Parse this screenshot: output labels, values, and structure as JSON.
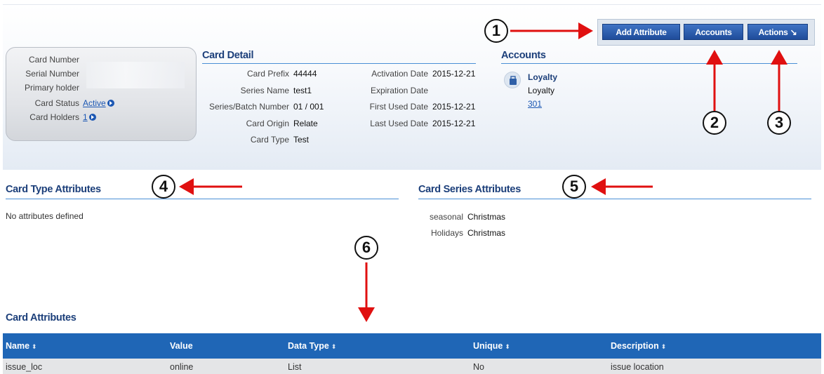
{
  "summary": {
    "card_number_label": "Card Number",
    "serial_number_label": "Serial Number",
    "primary_holder_label": "Primary holder",
    "card_status_label": "Card Status",
    "card_status_value": "Active",
    "card_holders_label": "Card Holders",
    "card_holders_value": "1"
  },
  "card_detail": {
    "title": "Card Detail",
    "left": [
      {
        "label": "Card Prefix",
        "value": "44444"
      },
      {
        "label": "Series Name",
        "value": "test1"
      },
      {
        "label": "Series/Batch Number",
        "value": "01 / 001"
      },
      {
        "label": "Card Origin",
        "value": "Relate"
      },
      {
        "label": "Card Type",
        "value": "Test"
      }
    ],
    "right": [
      {
        "label": "Activation Date",
        "value": "2015-12-21"
      },
      {
        "label": "Expiration Date",
        "value": ""
      },
      {
        "label": "First Used Date",
        "value": "2015-12-21"
      },
      {
        "label": "Last Used Date",
        "value": "2015-12-21"
      }
    ]
  },
  "accounts": {
    "title": "Accounts",
    "name": "Loyalty",
    "type": "Loyalty",
    "number": "301"
  },
  "toolbar": {
    "add_attribute": "Add Attribute",
    "accounts": "Accounts",
    "actions": "Actions ↘"
  },
  "card_type_attributes": {
    "title": "Card Type Attributes",
    "empty_text": "No attributes defined"
  },
  "card_series_attributes": {
    "title": "Card Series Attributes",
    "items": [
      {
        "label": "seasonal",
        "value": "Christmas"
      },
      {
        "label": "Holidays",
        "value": "Christmas"
      }
    ]
  },
  "card_attributes": {
    "title": "Card Attributes",
    "columns": [
      "Name",
      "Value",
      "Data Type",
      "Unique",
      "Description"
    ],
    "rows": [
      [
        "issue_loc",
        "online",
        "List",
        "No",
        "issue location"
      ]
    ]
  },
  "callouts": [
    "1",
    "2",
    "3",
    "4",
    "5",
    "6"
  ],
  "colors": {
    "title": "#1c3f7a",
    "rule": "#4a8fd6",
    "button": "#1f4c9a",
    "table_header": "#1f66b6",
    "arrow": "#e01010"
  }
}
